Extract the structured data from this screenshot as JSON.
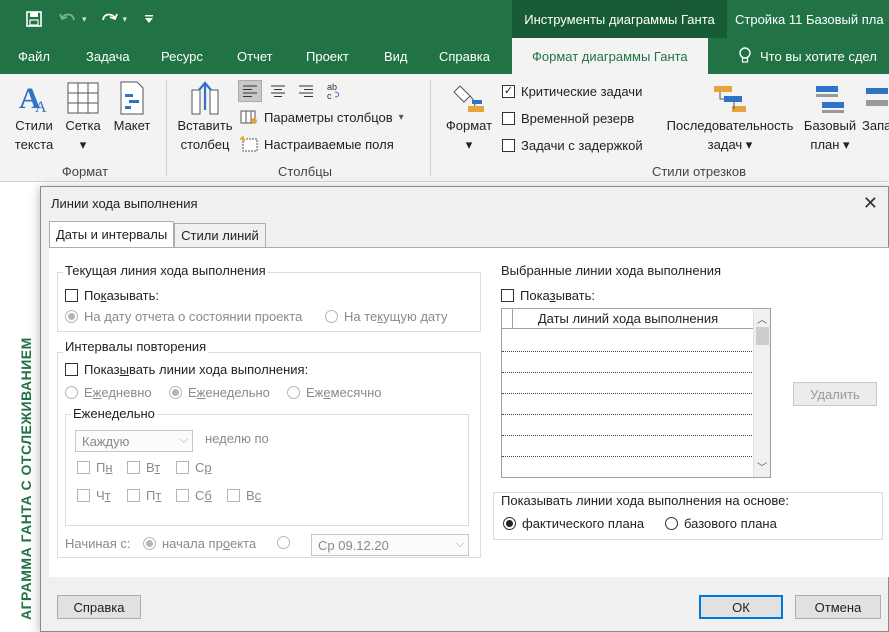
{
  "titlebar": {
    "context_label": "Инструменты диаграммы Ганта",
    "doc_title": "Стройка 11 Базовый пла"
  },
  "tabs": [
    "Файл",
    "Задача",
    "Ресурс",
    "Отчет",
    "Проект",
    "Вид",
    "Справка",
    "Формат диаграммы Ганта"
  ],
  "tell_me": "Что вы хотите сдел",
  "ribbon": {
    "format_group": {
      "label": "Формат",
      "text_styles": [
        "Стили",
        "текста"
      ],
      "gridlines": [
        "Сетка",
        "▾"
      ],
      "layout": "Макет"
    },
    "columns_group": {
      "label": "Столбцы",
      "insert_column": [
        "Вставить",
        "столбец"
      ],
      "column_settings": "Параметры столбцов",
      "custom_fields": "Настраиваемые поля"
    },
    "bar_styles_group": {
      "label": "Стили отрезков",
      "format": [
        "Формат",
        "▾"
      ],
      "critical_tasks": "Критические задачи",
      "slack": "Временной резерв",
      "late_tasks": "Задачи с задержкой",
      "task_path": [
        "Последовательность",
        "задач ▾"
      ],
      "baseline": [
        "Базовый",
        "план ▾"
      ],
      "slippage": "Запа"
    }
  },
  "side_label": "АГРАММА ГАНТА С ОТСЛЕЖИВАНИЕМ",
  "dialog": {
    "title": "Линии хода выполнения",
    "tabs": [
      "Даты и интервалы",
      "Стили линий"
    ],
    "current": {
      "title": "Текущая линия хода выполнения",
      "show": [
        "По",
        "к",
        "азывать:"
      ],
      "status_date": "На дату отчета о состоянии проекта",
      "current_date": [
        "На те",
        "к",
        "ущую дату"
      ]
    },
    "intervals": {
      "title": "Интервалы повторения",
      "show": [
        "Показ",
        "ы",
        "вать линии хода выполнения:"
      ],
      "daily": [
        "Е",
        "ж",
        "едневно"
      ],
      "weekly": [
        "Е",
        "ж",
        "енедельно"
      ],
      "monthly": [
        "Еж",
        "е",
        "месячно"
      ]
    },
    "weekly": {
      "title": "Еженедельно",
      "every": "Каждую",
      "week_on": "неделю по",
      "days": [
        [
          "П",
          "н"
        ],
        [
          "В",
          "т"
        ],
        [
          "С",
          "р"
        ],
        [
          "Ч",
          "т"
        ],
        [
          "П",
          "т"
        ],
        [
          "С",
          "б"
        ],
        [
          "В",
          "с"
        ]
      ]
    },
    "start": {
      "label": "Начиная с:",
      "project_start": [
        "начала пр",
        "о",
        "екта"
      ],
      "date": "Ср 09.12.20"
    },
    "selected": {
      "title": "Выбранные линии хода выполнения",
      "show": [
        "Пока",
        "з",
        "ывать:"
      ],
      "column": "Даты линий хода выполнения",
      "delete": "Удалить"
    },
    "basis": {
      "title": "Показывать линии хода выполнения на основе:",
      "actual": "фактического плана",
      "baseline": "базового плана"
    },
    "help": "Справка",
    "ok": "ОК",
    "cancel": "Отмена"
  }
}
